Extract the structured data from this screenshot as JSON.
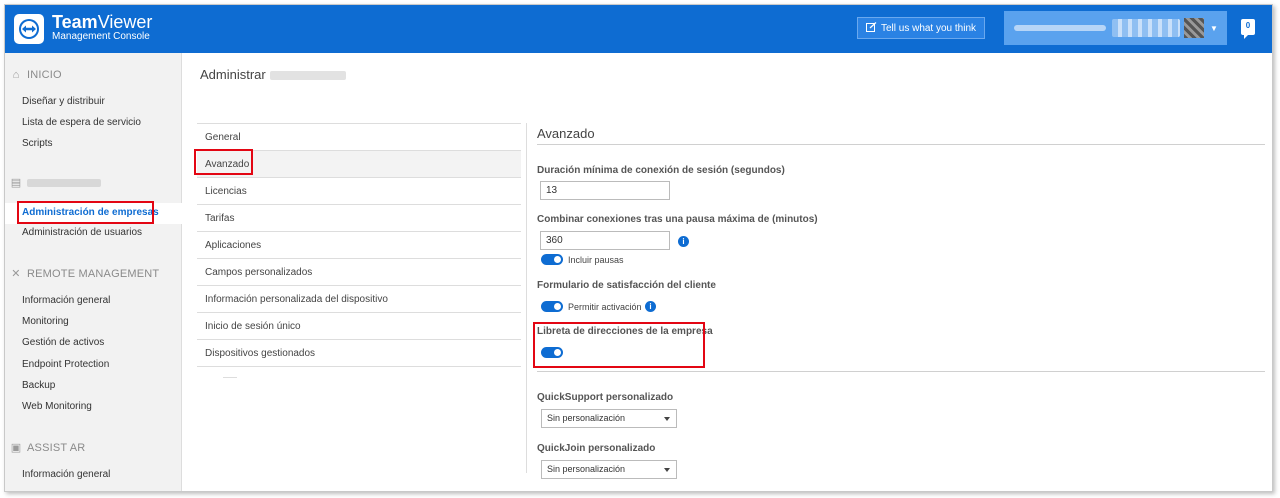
{
  "header": {
    "brand_bold": "Team",
    "brand_light": "Viewer",
    "brand_sub": "Management Console",
    "feedback_label": "Tell us what you think",
    "notification_count": "0",
    "accent_color": "#0e6cd2"
  },
  "sidebar": {
    "sections": [
      {
        "title": "INICIO",
        "icon": "home-icon",
        "items": [
          "Diseñar y distribuir",
          "Lista de espera de servicio",
          "Scripts"
        ]
      },
      {
        "title": "",
        "icon": "building-icon",
        "items": [
          "Administración de empresas",
          "Administración de usuarios"
        ]
      },
      {
        "title": "REMOTE MANAGEMENT",
        "icon": "remote-management-icon",
        "items": [
          "Información general",
          "Monitoring",
          "Gestión de activos",
          "Endpoint Protection",
          "Backup",
          "Web Monitoring"
        ]
      },
      {
        "title": "ASSIST AR",
        "icon": "assist-ar-icon",
        "items": [
          "Información general"
        ]
      }
    ],
    "active_item": "Administración de empresas"
  },
  "main": {
    "title": "Administrar",
    "tabs": [
      "General",
      "Avanzado",
      "Licencias",
      "Tarifas",
      "Aplicaciones",
      "Campos personalizados",
      "Información personalizada del dispositivo",
      "Inicio de sesión único",
      "Dispositivos gestionados"
    ],
    "selected_tab": "Avanzado"
  },
  "panel": {
    "title": "Avanzado",
    "min_duration_label": "Duración mínima de conexión de sesión (segundos)",
    "min_duration_value": "13",
    "combine_label": "Combinar conexiones tras una pausa máxima de (minutos)",
    "combine_value": "360",
    "include_pauses_label": "Incluir pausas",
    "include_pauses_on": true,
    "satisfaction_label": "Formulario de satisfacción del cliente",
    "allow_activation_label": "Permitir activación",
    "allow_activation_on": true,
    "address_book_label": "Libreta de direcciones de la empresa",
    "address_book_on": true,
    "quicksupport_label": "QuickSupport personalizado",
    "quicksupport_value": "Sin personalización",
    "quickjoin_label": "QuickJoin personalizado",
    "quickjoin_value": "Sin personalización"
  },
  "colors": {
    "highlight": "#e30613"
  }
}
